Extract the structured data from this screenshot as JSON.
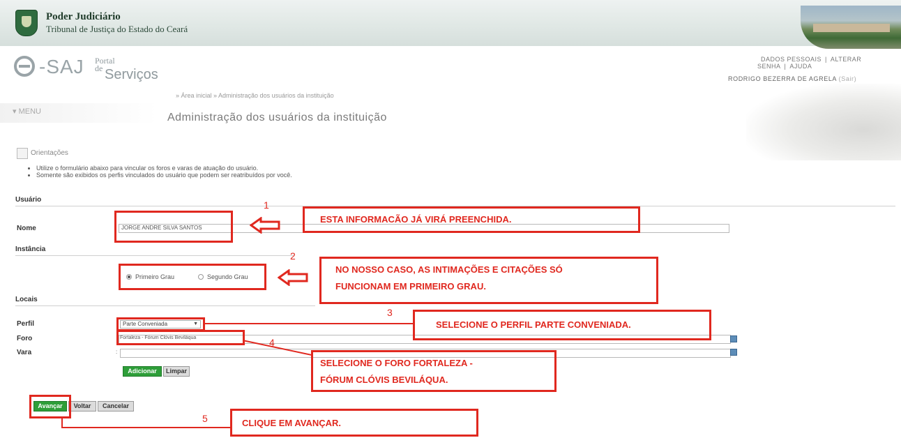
{
  "header": {
    "org_title": "Poder Judiciário",
    "org_subtitle": "Tribunal de Justiça do Estado do Ceará"
  },
  "logo": {
    "brand": "-SAJ",
    "portal": "Portal",
    "de": "de",
    "servicos": "Serviços"
  },
  "top_links": [
    "DADOS PESSOAIS",
    "ALTERAR SENHA",
    "AJUDA"
  ],
  "user": {
    "name": "RODRIGO BEZERRA DE AGRELA",
    "logout": "(Sair)"
  },
  "breadcrumb": "» Área inicial » Administração dos usuários da instituição",
  "menu": {
    "label": "MENU"
  },
  "page_title": "Administração dos usuários da instituição",
  "orientacoes": {
    "title": "Orientações",
    "items": [
      "Utilize o formulário abaixo para vincular os foros e varas de atuação do usuário.",
      "Somente são exibidos os perfis vinculados do usuário que podem ser reatribuídos por você."
    ]
  },
  "form": {
    "section_usuario": "Usuário",
    "section_instancia": "Instância",
    "section_locais": "Locais",
    "nome_label": "Nome",
    "nome_value": "JORGE ANDRE SILVA SANTOS",
    "instancia_options": [
      {
        "label": "Primeiro Grau",
        "checked": true
      },
      {
        "label": "Segundo Grau",
        "checked": false
      }
    ],
    "perfil_label": "Perfil",
    "perfil_value": "Parte Conveniada",
    "foro_label": "Foro",
    "foro_value": "Fortaleza - Fórum Clóvis Beviláqua",
    "vara_label": "Vara",
    "vara_value": ":",
    "adicionar": "Adicionar",
    "limpar": "Limpar",
    "avancar": "Avançar",
    "voltar": "Voltar",
    "cancelar": "Cancelar"
  },
  "annotations": {
    "n1": "1",
    "n2": "2",
    "n3": "3",
    "n4": "4",
    "n5": "5",
    "c1": "ESTA INFORMACÃO JÁ VIRÁ PREENCHIDA.",
    "c2a": "NO NOSSO CASO, AS INTIMAÇÕES E CITAÇÕES SÓ",
    "c2b": "FUNCIONAM EM PRIMEIRO GRAU.",
    "c3": "SELECIONE O PERFIL PARTE CONVENIADA.",
    "c4a": "SELECIONE O FORO FORTALEZA -",
    "c4b": "FÓRUM CLÓVIS BEVILÁQUA.",
    "c5": "CLIQUE EM AVANÇAR.",
    "color": "#e0281f"
  },
  "colors": {
    "green_button": "#2e9e39",
    "annotation_red": "#e0281f"
  }
}
